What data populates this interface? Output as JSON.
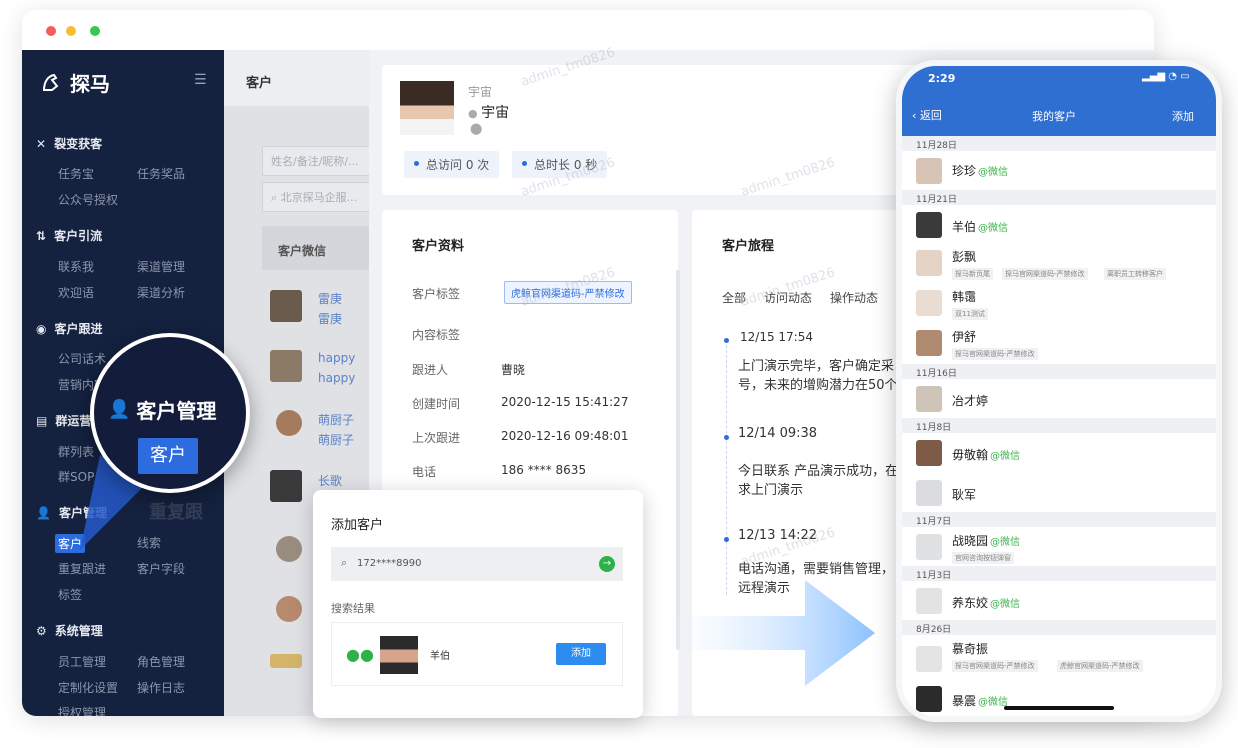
{
  "sidebar": {
    "brand": "探马",
    "sections": [
      {
        "title": "裂变获客",
        "items": [
          "任务宝",
          "任务奖品",
          "公众号授权"
        ]
      },
      {
        "title": "客户引流",
        "items": [
          "联系我",
          "渠道管理",
          "欢迎语",
          "渠道分析"
        ]
      },
      {
        "title": "客户跟进",
        "items": [
          "公司话术",
          "营销内容"
        ]
      },
      {
        "title": "群运营",
        "items": [
          "群列表",
          "群SOP"
        ]
      },
      {
        "title": "客户管理",
        "items": [
          "客户",
          "线索",
          "重复跟进",
          "客户字段",
          "标签"
        ]
      },
      {
        "title": "系统管理",
        "items": [
          "员工管理",
          "角色管理",
          "定制化设置",
          "操作日志",
          "授权管理"
        ]
      }
    ]
  },
  "mid": {
    "header": "客户",
    "search1": "姓名/备注/昵称/...",
    "search2": "北京探马企服...",
    "col_header": "客户微信",
    "rows": [
      {
        "n1": "雷庚",
        "n2": "雷庚"
      },
      {
        "n1": "happy",
        "n2": "happy"
      },
      {
        "n1": "萌厨子",
        "n2": "萌厨子"
      },
      {
        "n1": "长歌",
        "n2": ""
      }
    ],
    "ghost": "重复跟"
  },
  "profile": {
    "name_top": "宇宙",
    "name": "宇宙",
    "visits": "总访问 0 次",
    "duration": "总时长 0 秒"
  },
  "info": {
    "title": "客户资料",
    "fields": [
      {
        "label": "客户标签",
        "value": ""
      },
      {
        "label": "内容标签",
        "value": ""
      },
      {
        "label": "跟进人",
        "value": "曹晓"
      },
      {
        "label": "创建时间",
        "value": "2020-12-15 15:41:27"
      },
      {
        "label": "上次跟进",
        "value": "2020-12-16 09:48:01"
      },
      {
        "label": "电话",
        "value": "186 **** 8635"
      }
    ],
    "tag": "虎鲸官网渠道码-严禁修改"
  },
  "journey": {
    "title": "客户旅程",
    "tabs": [
      "全部",
      "访问动态",
      "操作动态"
    ],
    "events": [
      {
        "time": "12/15   17:54",
        "l1": "上门演示完毕，客户确定采",
        "l2": "号，未来的增购潜力在50个"
      },
      {
        "time": "12/14 09:38",
        "l1": "今日联系 产品演示成功，在",
        "l2": "求上门演示"
      },
      {
        "time": "12/13 14:22",
        "l1": "电话沟通，需要销售管理，",
        "l2": "远程演示"
      }
    ]
  },
  "add_dialog": {
    "title": "添加客户",
    "search_value": "172****8990",
    "results_label": "搜索结果",
    "result_name": "羊伯",
    "add_button": "添加"
  },
  "zoom": {
    "title": "客户管理",
    "button": "客户"
  },
  "phone": {
    "time": "2:29",
    "back": "返回",
    "title": "我的客户",
    "add": "添加",
    "groups": [
      {
        "date": "11月28日",
        "rows": [
          {
            "name": "珍珍",
            "wx": "@微信",
            "tags": []
          }
        ]
      },
      {
        "date": "11月21日",
        "rows": [
          {
            "name": "羊伯",
            "wx": "@微信",
            "tags": []
          },
          {
            "name": "彭飘",
            "wx": "",
            "tags": [
              "探马新页尾",
              "探马官网渠道码-严禁修改",
              "离职员工转移客户"
            ]
          },
          {
            "name": "韩霭",
            "wx": "",
            "tags": [
              "双11测试"
            ]
          },
          {
            "name": "伊舒",
            "wx": "",
            "tags": [
              "探马官网渠道码-严禁修改"
            ]
          }
        ]
      },
      {
        "date": "11月16日",
        "rows": [
          {
            "name": "冶才婷",
            "wx": "",
            "tags": []
          }
        ]
      },
      {
        "date": "11月8日",
        "rows": [
          {
            "name": "毋敬翰",
            "wx": "@微信",
            "tags": []
          },
          {
            "name": "耿军",
            "wx": "",
            "tags": []
          }
        ]
      },
      {
        "date": "11月7日",
        "rows": [
          {
            "name": "战晓园",
            "wx": "@微信",
            "tags": [
              "官网咨询按钮弹窗"
            ]
          }
        ]
      },
      {
        "date": "11月3日",
        "rows": [
          {
            "name": "养东姣",
            "wx": "@微信",
            "tags": []
          }
        ]
      },
      {
        "date": "8月26日",
        "rows": [
          {
            "name": "慕奇振",
            "wx": "",
            "tags": [
              "探马官网渠道码-严禁修改",
              "虎鲸官网渠道码-严禁修改"
            ]
          },
          {
            "name": "暴震",
            "wx": "@微信",
            "tags": []
          }
        ]
      }
    ]
  },
  "watermark": "admin_tm0826",
  "colors": {
    "accent": "#2d6cdf",
    "sidebar": "#14213f",
    "wechat": "#3bb34a"
  }
}
